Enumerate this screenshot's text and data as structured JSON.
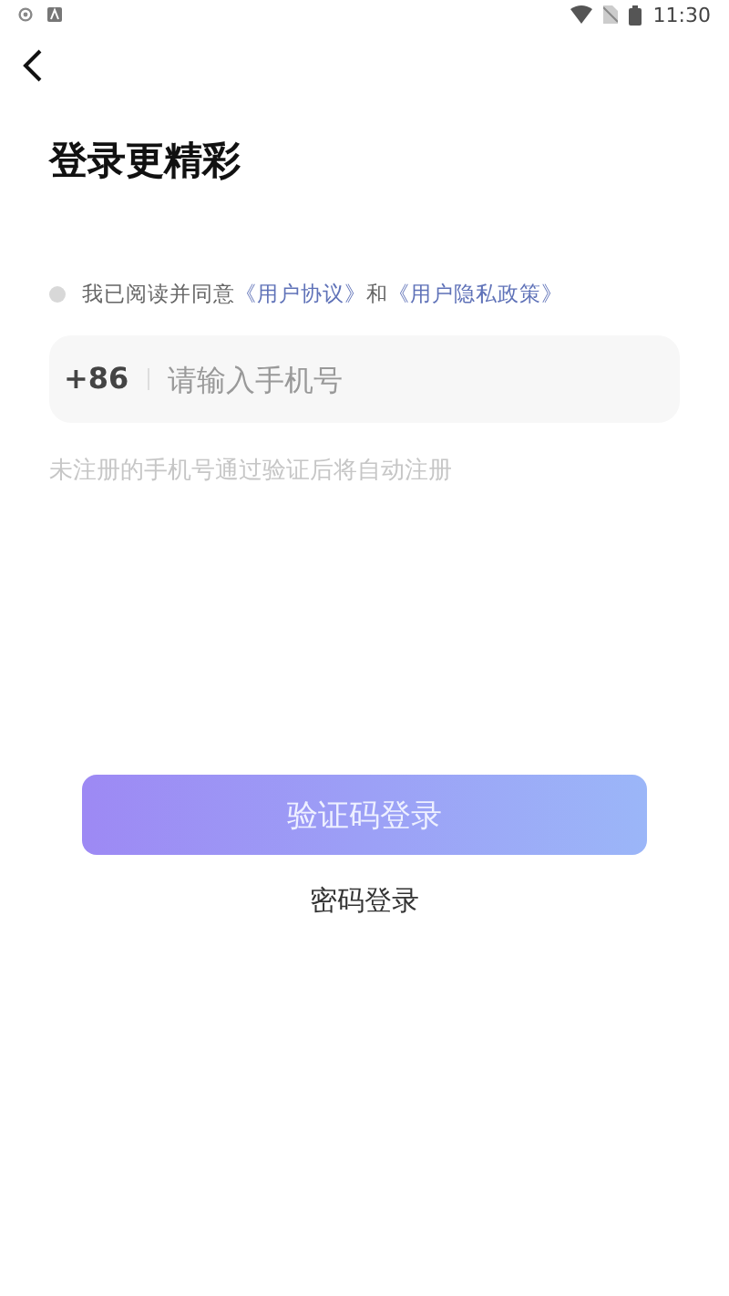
{
  "status_bar": {
    "time": "11:30"
  },
  "title": "登录更精彩",
  "agreement": {
    "checked": false,
    "prefix": "我已阅读并同意",
    "links": [
      {
        "label": "《用户协议》"
      },
      {
        "label": "《用户隐私政策》"
      }
    ],
    "joiner": "和"
  },
  "phone_field": {
    "country_code": "+86",
    "placeholder": "请输入手机号"
  },
  "hint": "未注册的手机号通过验证后将自动注册",
  "primary_button": {
    "label": "验证码登录"
  },
  "secondary_link": {
    "label": "密码登录"
  }
}
